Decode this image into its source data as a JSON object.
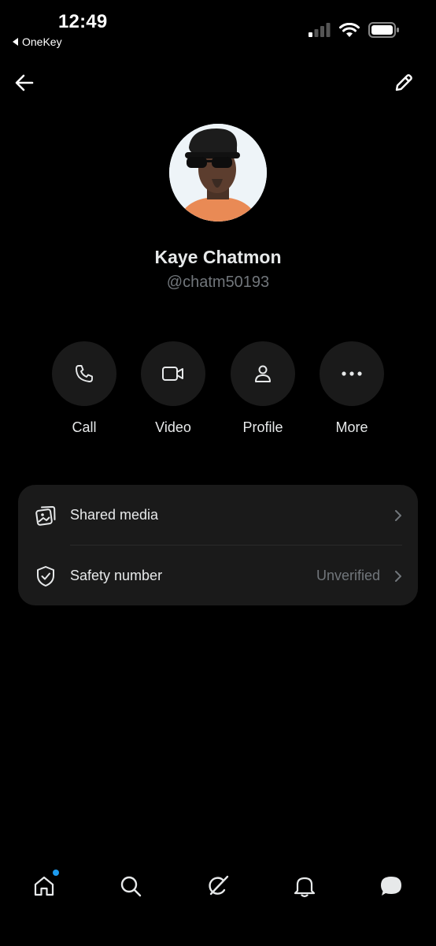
{
  "status_bar": {
    "time": "12:49",
    "back_app": "OneKey"
  },
  "header": {
    "back_icon": "arrow-left-icon",
    "edit_icon": "pencil-icon"
  },
  "profile": {
    "name": "Kaye Chatmon",
    "handle": "@chatm50193"
  },
  "actions": [
    {
      "label": "Call",
      "icon": "phone-icon"
    },
    {
      "label": "Video",
      "icon": "video-camera-icon"
    },
    {
      "label": "Profile",
      "icon": "person-icon"
    },
    {
      "label": "More",
      "icon": "more-dots-icon"
    }
  ],
  "settings": {
    "shared_media": {
      "label": "Shared media",
      "icon": "media-gallery-icon"
    },
    "safety_number": {
      "label": "Safety number",
      "value": "Unverified",
      "icon": "shield-check-icon"
    }
  },
  "bottom_nav": [
    {
      "name": "home",
      "icon": "home-icon",
      "badge": true
    },
    {
      "name": "search",
      "icon": "search-icon"
    },
    {
      "name": "grok",
      "icon": "grok-icon"
    },
    {
      "name": "notifications",
      "icon": "bell-icon"
    },
    {
      "name": "messages",
      "icon": "message-bubble-icon"
    }
  ],
  "colors": {
    "background": "#000000",
    "surface": "#1a1a1a",
    "text_primary": "#e7e9ea",
    "text_secondary": "#71767b",
    "accent": "#1d9bf0"
  }
}
